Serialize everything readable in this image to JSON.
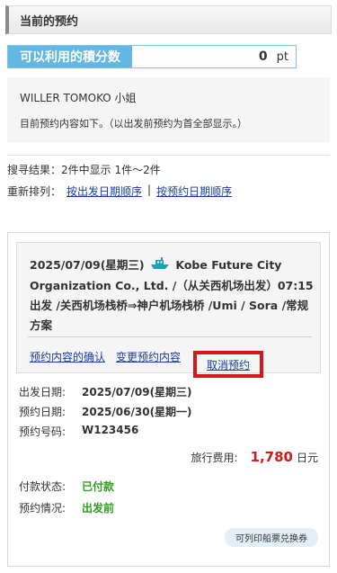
{
  "header": {
    "title": "当前的预约"
  },
  "points": {
    "label": "可以利用的積分数",
    "value": "0",
    "unit": "pt"
  },
  "customer": {
    "name": "WILLER TOMOKO 小姐",
    "note": "目前预约内容如下。（以出发前预约为首全部显示。）"
  },
  "search": {
    "result": "搜寻结果：2件中显示 1件～2件",
    "sort_label": "重新排列：",
    "sort_departure": "按出发日期顺序",
    "sort_separator": "|",
    "sort_booking": "按预约日期顺序"
  },
  "reservation": {
    "date": "2025/07/09(星期三)",
    "operator": "Kobe Future City Organization Co., Ltd. /（从关西机场出发）07:15出发 /关西机场栈桥⇒神户机场栈桥 /Umi / Sora /常规方案",
    "actions": {
      "confirm": "预约内容的确认",
      "change": "变更预约内容",
      "cancel": "取消预约"
    },
    "details": {
      "departure_label": "出发日期:",
      "departure_value": "2025/07/09(星期三)",
      "booking_label": "预约日期:",
      "booking_value": "2025/06/30(星期一)",
      "number_label": "预约号码:",
      "number_value": "W123456"
    },
    "fee": {
      "label": "旅行费用:",
      "value": "1,780",
      "unit": "日元"
    },
    "payment": {
      "label": "付款状态:",
      "value": "已付款"
    },
    "status": {
      "label": "预约情况:",
      "value": "出发前"
    },
    "badge": "可列印船票兑换券"
  },
  "colors": {
    "accent_blue": "#63b7e3",
    "link": "#1a3e9c",
    "highlight_red": "#d21a1a",
    "status_green": "#2f9e1f"
  }
}
